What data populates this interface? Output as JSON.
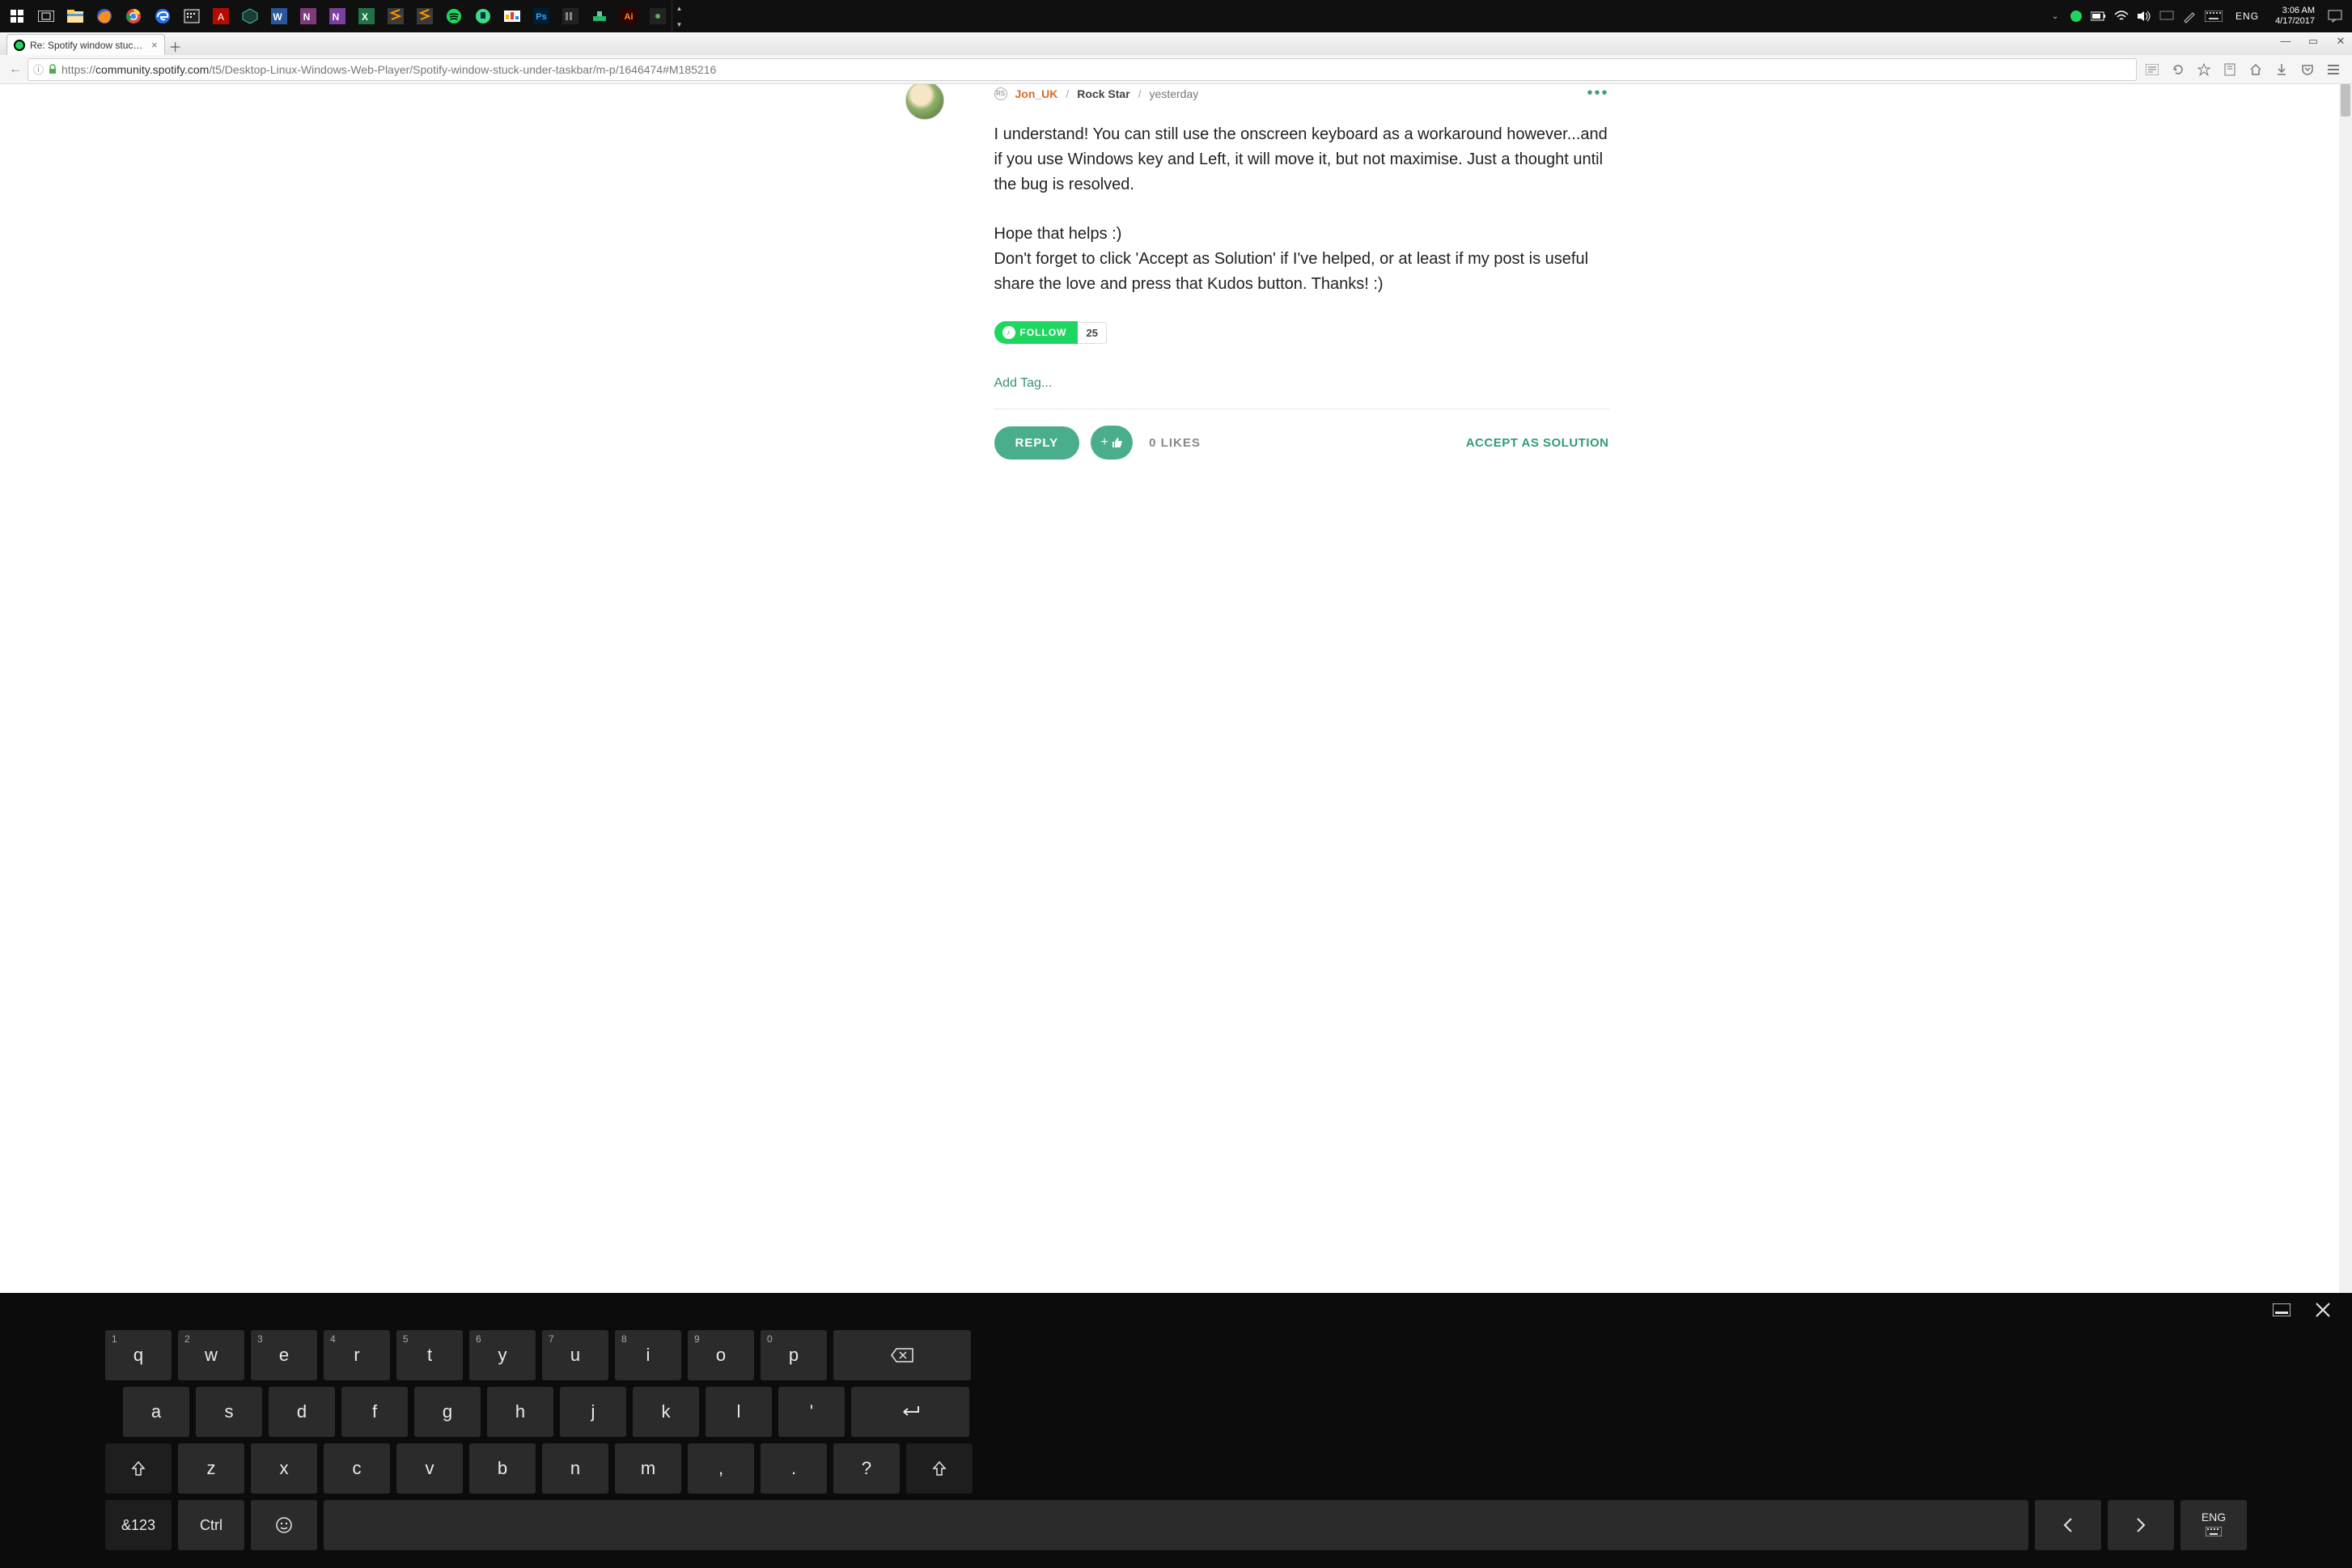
{
  "system": {
    "time": "3:06 AM",
    "date": "4/17/2017",
    "language": "ENG"
  },
  "taskbar_apps": [
    "start",
    "taskview",
    "file-explorer",
    "firefox",
    "chrome",
    "edge",
    "calendar",
    "acrobat",
    "node",
    "word",
    "onenote",
    "onenote-clip",
    "excel",
    "sublime",
    "sublime-alt",
    "spotify",
    "android-studio",
    "mpc",
    "photoshop",
    "foobar",
    "process",
    "illustrator",
    "qt"
  ],
  "tray_icons": [
    "dropdown",
    "spotify",
    "battery",
    "wifi",
    "volume",
    "monitor",
    "pen",
    "keyboard"
  ],
  "browser": {
    "tab_title": "Re: Spotify window stuck ...",
    "url_prefix": "https://",
    "url_host": "community.spotify.com",
    "url_path": "/t5/Desktop-Linux-Windows-Web-Player/Spotify-window-stuck-under-taskbar/m-p/1646474#M185216"
  },
  "post": {
    "author": "Jon_UK",
    "rank": "Rock Star",
    "timestamp": "yesterday",
    "paragraph1": "I understand! You can still use the onscreen keyboard as a workaround however...and if you use Windows key and Left, it will move it, but not maximise. Just a thought until the bug is resolved.",
    "paragraph2": "Hope that helps :)\nDon't forget to click 'Accept as Solution' if I've helped, or at least if my post is useful share the love and press that Kudos button. Thanks! :)",
    "follow_label": "FOLLOW",
    "follow_count": "25",
    "add_tag": "Add Tag...",
    "reply": "REPLY",
    "likes_count": "0",
    "likes_label": "LIKES",
    "accept": "ACCEPT AS SOLUTION"
  },
  "osk": {
    "row1": [
      {
        "main": "q",
        "sup": "1"
      },
      {
        "main": "w",
        "sup": "2"
      },
      {
        "main": "e",
        "sup": "3"
      },
      {
        "main": "r",
        "sup": "4"
      },
      {
        "main": "t",
        "sup": "5"
      },
      {
        "main": "y",
        "sup": "6"
      },
      {
        "main": "u",
        "sup": "7"
      },
      {
        "main": "i",
        "sup": "8"
      },
      {
        "main": "o",
        "sup": "9"
      },
      {
        "main": "p",
        "sup": "0"
      }
    ],
    "row2": [
      "a",
      "s",
      "d",
      "f",
      "g",
      "h",
      "j",
      "k",
      "l",
      "'"
    ],
    "row3": [
      "z",
      "x",
      "c",
      "v",
      "b",
      "n",
      "m",
      ",",
      ".",
      "?"
    ],
    "row4": {
      "sym": "&123",
      "ctrl": "Ctrl",
      "lang_main": "ENG"
    }
  }
}
